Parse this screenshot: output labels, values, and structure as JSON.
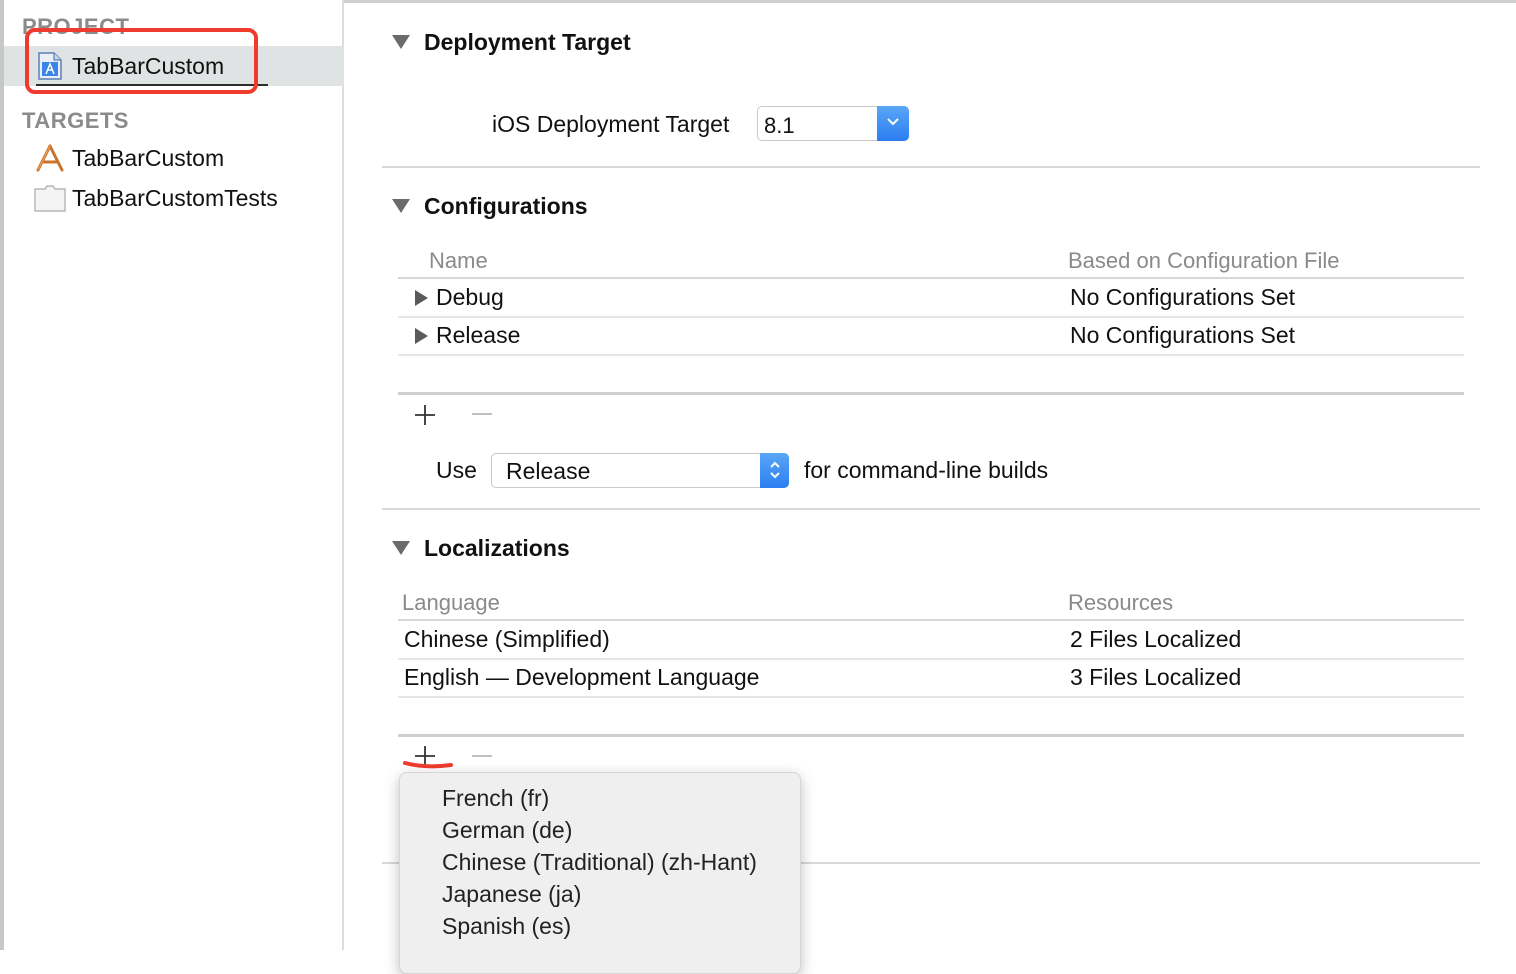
{
  "sidebar": {
    "project_header": "PROJECT",
    "project_item": "TabBarCustom",
    "targets_header": "TARGETS",
    "targets": [
      "TabBarCustom",
      "TabBarCustomTests"
    ]
  },
  "deployment": {
    "title": "Deployment Target",
    "label": "iOS Deployment Target",
    "value": "8.1"
  },
  "configurations": {
    "title": "Configurations",
    "col_name": "Name",
    "col_file": "Based on Configuration File",
    "rows": [
      {
        "name": "Debug",
        "file": "No Configurations Set"
      },
      {
        "name": "Release",
        "file": "No Configurations Set"
      }
    ],
    "use_label": "Use",
    "use_value": "Release",
    "use_suffix": "for command-line builds"
  },
  "localizations": {
    "title": "Localizations",
    "col_language": "Language",
    "col_resources": "Resources",
    "rows": [
      {
        "language": "Chinese (Simplified)",
        "resources": "2 Files Localized"
      },
      {
        "language": "English — Development Language",
        "resources": "3 Files Localized"
      }
    ]
  },
  "language_menu": [
    "French (fr)",
    "German (de)",
    "Chinese (Traditional) (zh-Hant)",
    "Japanese (ja)",
    "Spanish (es)"
  ],
  "colors": {
    "highlight": "#ef3b2d",
    "accent": "#2b7ef0"
  }
}
